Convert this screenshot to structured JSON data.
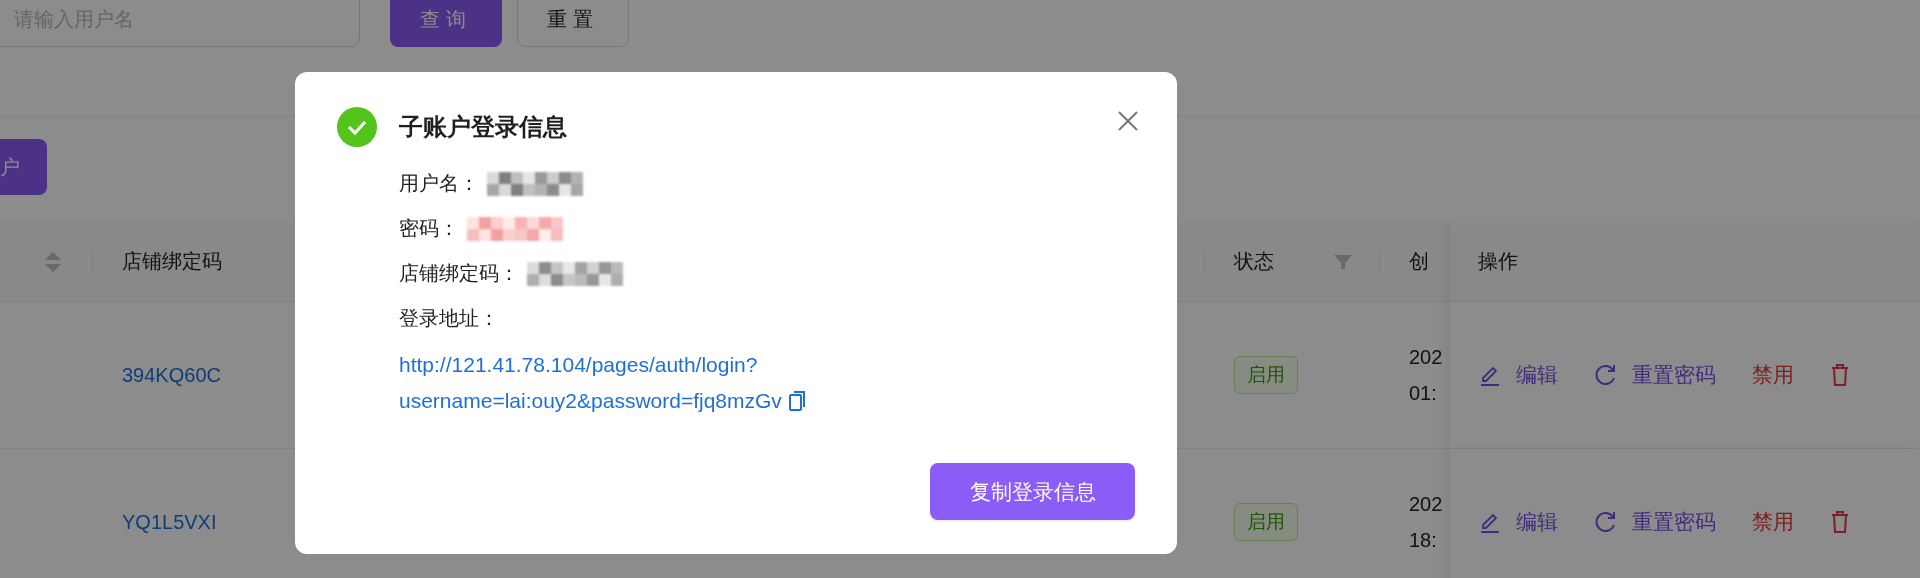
{
  "toolbar": {
    "search": {
      "placeholder": "请输入用户名"
    },
    "buttons": [
      {
        "label": "查询",
        "kind": "primary"
      },
      {
        "label": "重置",
        "kind": "default"
      }
    ],
    "add_button": {
      "label": "户"
    }
  },
  "table": {
    "columns": [
      {
        "kind": "sort"
      },
      {
        "label": "店铺绑定码",
        "kind": "plain"
      },
      {
        "label": "状态",
        "kind": "filter"
      },
      {
        "label": "创",
        "kind": "plain"
      },
      {
        "label": "操作",
        "kind": "plain"
      }
    ],
    "rows": [
      {
        "bind_code": "394KQ60C",
        "status": {
          "label": "启用",
          "kind": "enabled"
        },
        "created": [
          "202",
          "01:"
        ],
        "actions": [
          {
            "kind": "edit",
            "label": "编辑"
          },
          {
            "kind": "reset",
            "label": "重置密码"
          },
          {
            "kind": "disable",
            "label": "禁用"
          },
          {
            "kind": "delete"
          }
        ]
      },
      {
        "bind_code": "YQ1L5VXI",
        "status": {
          "label": "启用",
          "kind": "enabled"
        },
        "created": [
          "202",
          "18:"
        ],
        "actions": [
          {
            "kind": "edit",
            "label": "编辑"
          },
          {
            "kind": "reset",
            "label": "重置密码"
          },
          {
            "kind": "disable",
            "label": "禁用"
          },
          {
            "kind": "delete"
          }
        ]
      }
    ]
  },
  "modal": {
    "title": "子账户登录信息",
    "fields": [
      {
        "label": "用户名：",
        "redacted": true,
        "color": "#808080"
      },
      {
        "label": "密码：",
        "redacted": true,
        "color": "#f4a0a0"
      },
      {
        "label": "店铺绑定码：",
        "redacted": true,
        "color": "#8c8c8c"
      },
      {
        "label": "登录地址：",
        "redacted": false
      }
    ],
    "link_lines": [
      "http://121.41.78.104/pages/auth/login?",
      "username=lai:ouy2&password=fjq8mzGv"
    ],
    "copy_button": {
      "label": "复制登录信息"
    }
  }
}
